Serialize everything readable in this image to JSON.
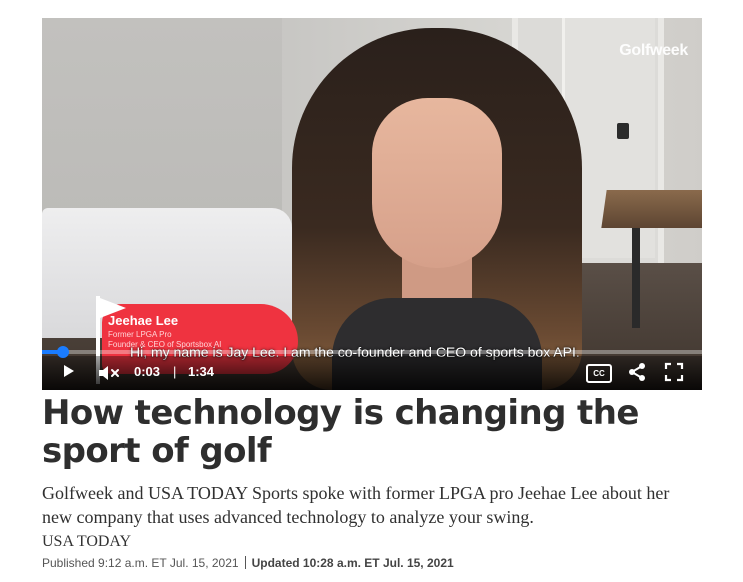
{
  "video": {
    "watermark": "Golfweek",
    "lower_third": {
      "name": "Jeehae Lee",
      "line1": "Former LPGA Pro",
      "line2": "Founder & CEO of Sportsbox AI"
    },
    "caption": "Hi, my name is Jay Lee. I am the co-founder and CEO of sports box API.",
    "controls": {
      "current_time": "0:03",
      "separator": "|",
      "duration": "1:34",
      "cc_label": "CC",
      "progress_fraction": 0.032
    }
  },
  "article": {
    "headline": "How technology is changing the sport of golf",
    "summary": "Golfweek and USA TODAY Sports spoke with former LPGA pro Jeehae Lee about her new company that uses advanced technology to analyze your swing.",
    "source": "USA TODAY",
    "published": "Published 9:12 a.m. ET Jul. 15, 2021",
    "updated": "Updated 10:28 a.m. ET Jul. 15, 2021"
  },
  "colors": {
    "accent": "#ef3340",
    "progress": "#1a7cff",
    "headline": "#2e2e2e"
  },
  "icons": [
    "play-icon",
    "muted-speaker-icon",
    "closed-captions-icon",
    "share-icon",
    "fullscreen-icon"
  ]
}
